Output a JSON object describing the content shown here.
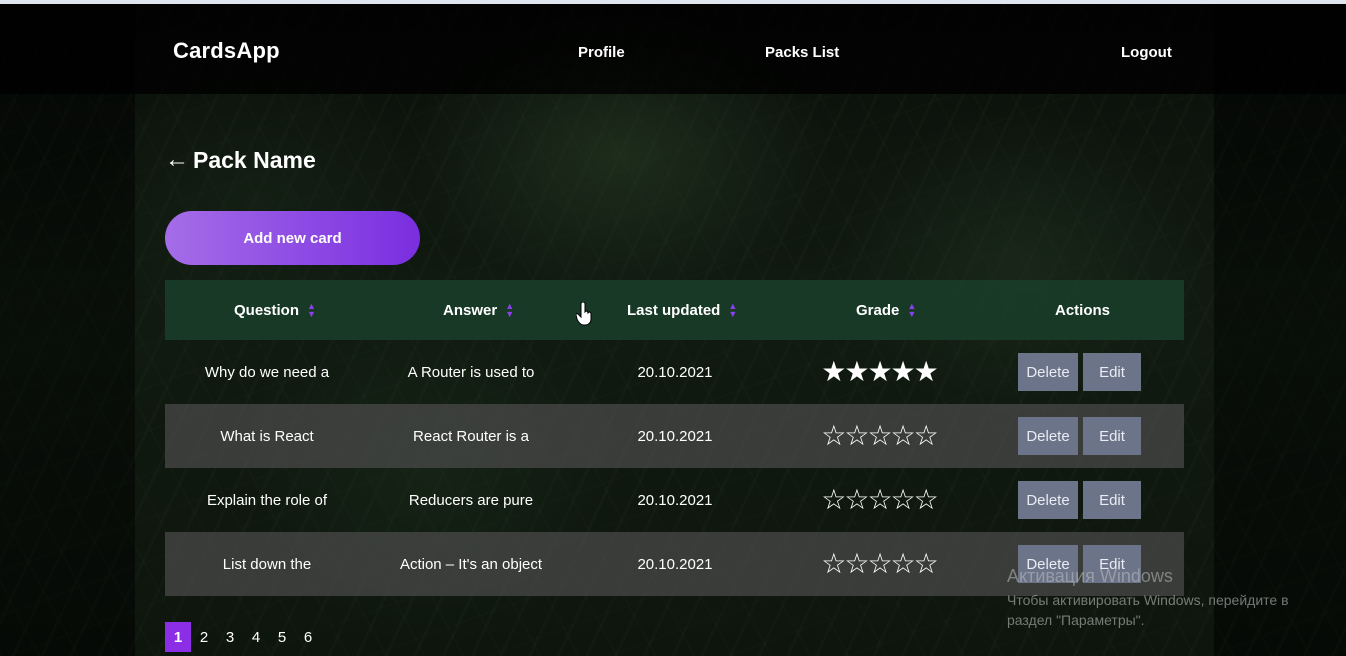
{
  "app": {
    "title": "CardsApp"
  },
  "nav": {
    "profile": "Profile",
    "packs_list": "Packs List",
    "logout": "Logout"
  },
  "pack": {
    "back_arrow": "←",
    "name": "Pack Name"
  },
  "add_button": {
    "label": "Add new card"
  },
  "table": {
    "columns": [
      "Question",
      "Answer",
      "Last updated",
      "Grade",
      "Actions"
    ],
    "rows": [
      {
        "question": "Why do we need a",
        "answer": "A Router is used to",
        "updated": "20.10.2021",
        "grade": 5,
        "stars": "★★★★★"
      },
      {
        "question": "What is React",
        "answer": "React Router is a",
        "updated": "20.10.2021",
        "grade": 0,
        "stars": "☆☆☆☆☆"
      },
      {
        "question": "Explain the role of",
        "answer": "Reducers are pure",
        "updated": "20.10.2021",
        "grade": 0,
        "stars": "☆☆☆☆☆"
      },
      {
        "question": "List down the",
        "answer": "Action – It's an object",
        "updated": "20.10.2021",
        "grade": 0,
        "stars": "☆☆☆☆☆"
      }
    ],
    "delete_label": "Delete",
    "edit_label": "Edit"
  },
  "pagination": {
    "pages": [
      "1",
      "2",
      "3",
      "4",
      "5",
      "6"
    ],
    "current": "1"
  },
  "watermark": {
    "title": "Активация Windows",
    "text": "Чтобы активировать Windows, перейдите в раздел \"Параметры\"."
  },
  "colors": {
    "accent": "#8b2ee6",
    "header_row": "#193c28",
    "button": "#6c7489"
  }
}
